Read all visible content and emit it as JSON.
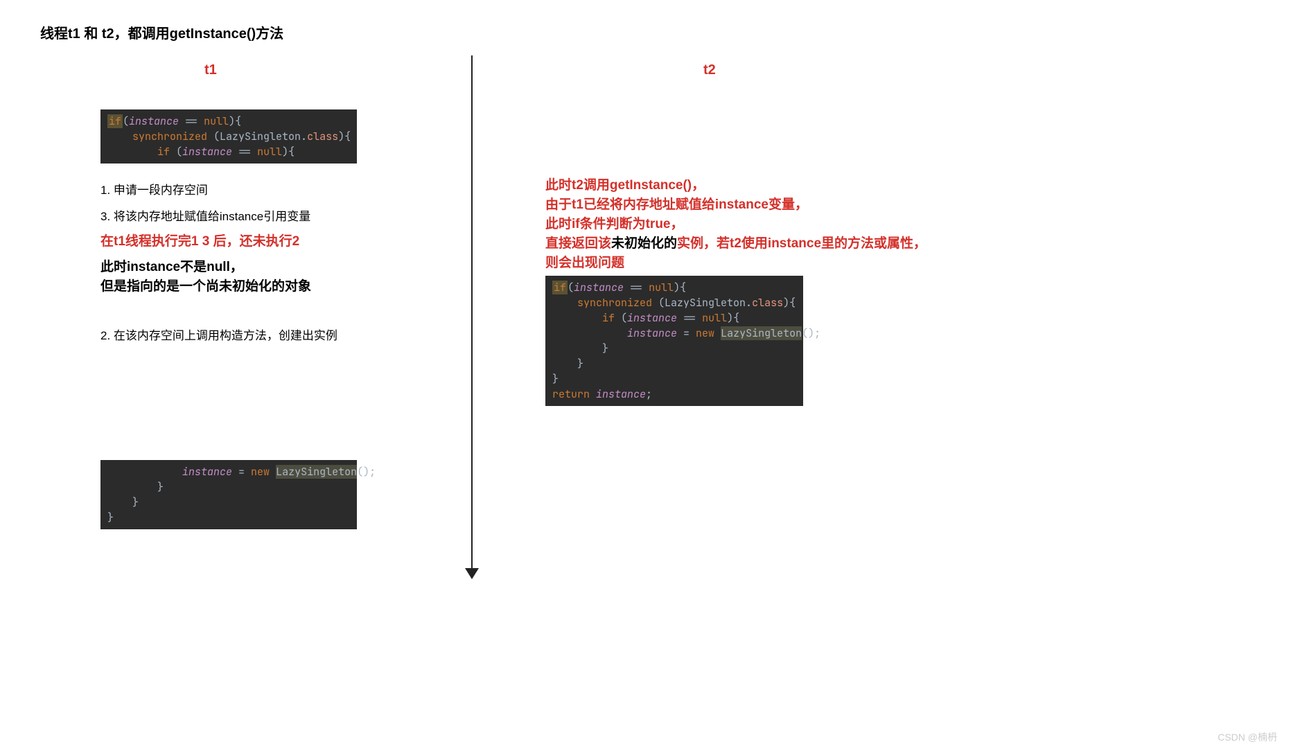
{
  "title": "线程t1 和 t2，都调用getInstance()方法",
  "labels": {
    "t1": "t1",
    "t2": "t2"
  },
  "code": {
    "block1": {
      "l1a": "if",
      "l1b": "(",
      "l1c": "instance",
      "l1d": " == ",
      "l1e": "null",
      "l1f": "){",
      "l2a": "    ",
      "l2b": "synchronized",
      "l2c": " (LazySingleton",
      "l2d": ".",
      "l2e": "class",
      "l2f": "){",
      "l3a": "        ",
      "l3b": "if",
      "l3c": " (",
      "l3d": "instance",
      "l3e": " == ",
      "l3f": "null",
      "l3g": "){"
    },
    "block2": {
      "l1a": "            ",
      "l1b": "instance",
      "l1c": " = ",
      "l1d": "new",
      "l1e": " ",
      "l1f": "LazySingleton",
      "l1g": "();",
      "l2": "        }",
      "l3": "    }",
      "l4": "}"
    },
    "block3": {
      "l1a": "if",
      "l1b": "(",
      "l1c": "instance",
      "l1d": " == ",
      "l1e": "null",
      "l1f": "){",
      "l2a": "    ",
      "l2b": "synchronized",
      "l2c": " (LazySingleton",
      "l2d": ".",
      "l2e": "class",
      "l2f": "){",
      "l3a": "        ",
      "l3b": "if",
      "l3c": " (",
      "l3d": "instance",
      "l3e": " == ",
      "l3f": "null",
      "l3g": "){",
      "l4a": "            ",
      "l4b": "instance",
      "l4c": " = ",
      "l4d": "new",
      "l4e": " ",
      "l4f": "LazySingleton",
      "l4g": "();",
      "l5": "        }",
      "l6": "    }",
      "l7": "}",
      "l8a": "return",
      "l8b": " ",
      "l8c": "instance",
      "l8d": ";"
    }
  },
  "left": {
    "step1": "1. 申请一段内存空间",
    "step3": "3. 将该内存地址赋值给instance引用变量",
    "red": "在t1线程执行完1 3 后，还未执行2",
    "b1": "此时instance不是null，",
    "b2": "但是指向的是一个尚未初始化的对象",
    "step2": "2. 在该内存空间上调用构造方法，创建出实例"
  },
  "right": {
    "r1": "此时t2调用getInstance()，",
    "r2": "由于t1已经将内存地址赋值给instance变量，",
    "r3": "此时if条件判断为true，",
    "r4a": "直接返回该",
    "r4b": "未初始化的",
    "r4c": "实例，若t2使用instance里的方法或属性，",
    "r5": "则会出现问题"
  },
  "watermark": "CSDN @楠枬"
}
